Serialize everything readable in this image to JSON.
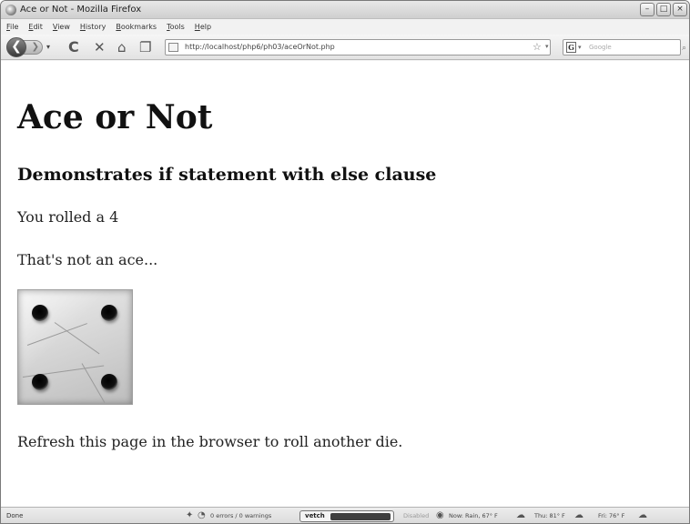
{
  "window": {
    "title": "Ace or Not - Mozilla Firefox",
    "buttons": {
      "minimize": "–",
      "maximize": "□",
      "close": "×"
    }
  },
  "menu": [
    "File",
    "Edit",
    "View",
    "History",
    "Bookmarks",
    "Tools",
    "Help"
  ],
  "toolbar": {
    "back_glyph": "❮",
    "forward_glyph": "❯",
    "dropdown_glyph": "▾",
    "reload_glyph": "C",
    "stop_glyph": "✕",
    "home_glyph": "⌂",
    "bookmark_glyph": "❐",
    "url": "http://localhost/php6/ph03/aceOrNot.php",
    "star_glyph": "☆",
    "url_dropdown_glyph": "▾",
    "search_engine_glyph": "G",
    "search_dropdown_glyph": "▾",
    "search_placeholder": "Google",
    "search_go_glyph": "⌕"
  },
  "page": {
    "title": "Ace or Not",
    "subtitle": "Demonstrates if statement with else clause",
    "roll_text": "You rolled a 4",
    "result_text": "That's not an ace...",
    "die_value": 4,
    "refresh_text": "Refresh this page in the browser to roll another die."
  },
  "statusbar": {
    "status": "Done",
    "errors": "0 errors / 0 warnings",
    "vetch_label": "vetch",
    "disabled": "Disabled",
    "weather_now": "Now: Rain, 67° F",
    "weather_thu": "Thu: 81° F",
    "weather_fri": "Fri: 76° F"
  }
}
